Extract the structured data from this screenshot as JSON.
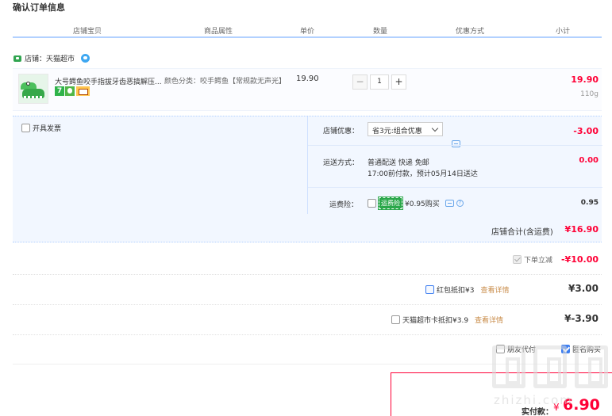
{
  "page": {
    "title": "确认订单信息"
  },
  "columns": [
    "店铺宝贝",
    "商品属性",
    "单价",
    "数量",
    "优惠方式",
    "小计"
  ],
  "shop": {
    "label": "店铺：天猫超市"
  },
  "item": {
    "name": "大号鳄鱼咬手指拔牙齿恶搞解压...",
    "badge_number": "7",
    "attr": "颜色分类：咬手鳄鱼【常规款无声光】",
    "unit_price": "19.90",
    "quantity": "1",
    "qty_minus": "−",
    "qty_plus": "+",
    "subtotal": "19.90",
    "weight": "110g"
  },
  "services": {
    "invoice_label": "开具发票",
    "shop_discount_label": "店铺优惠：",
    "shop_discount_option": "省3元:组合优惠",
    "shop_discount_amount": "-3.00",
    "shipping_label": "运送方式：",
    "shipping_method": "普通配送 快递 免邮",
    "shipping_note": "17:00前付款，预计05月14日送达",
    "shipping_amount": "0.00",
    "insurance_label": "运费险：",
    "insurance_badge": "运费险",
    "insurance_text": "¥0.95购买",
    "insurance_amount": "0.95",
    "help_glyph": "?",
    "shop_total_label": "店铺合计(含运费)",
    "shop_total_amount": "¥16.90"
  },
  "discounts": {
    "instant_label": "下单立减",
    "instant_amount": "-¥10.00",
    "redpacket_label": "红包抵扣¥3",
    "redpacket_detail": "查看详情",
    "redpacket_amount": "¥3.00",
    "card_label": "天猫超市卡抵扣¥3.9",
    "card_detail": "查看详情",
    "card_amount": "¥-3.90",
    "friend_pay_label": "朋友代付",
    "anonymous_label": "匿名购买"
  },
  "payment": {
    "label": "实付款：",
    "currency": "¥",
    "amount": "6.90"
  },
  "watermark": {
    "text": "zhizhi.com"
  },
  "colors": {
    "accent_red": "#ff0036",
    "header_line": "#b2d1ff",
    "service_bg": "#f2f7ff",
    "link_blue": "#3d7ef0"
  }
}
